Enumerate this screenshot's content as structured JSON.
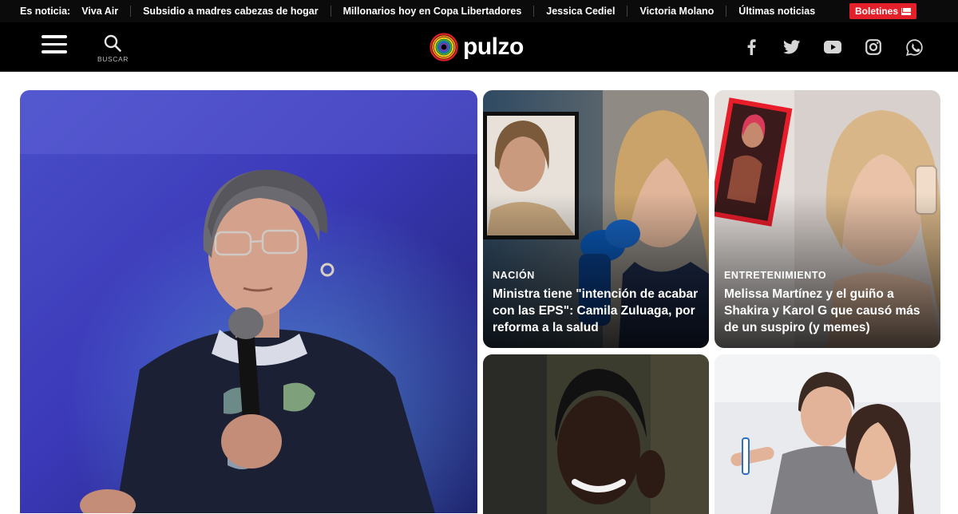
{
  "topbar": {
    "label": "Es noticia:",
    "links": [
      "Viva Air",
      "Subsidio a madres cabezas de hogar",
      "Millonarios hoy en Copa Libertadores",
      "Jessica Cediel",
      "Victoria Molano",
      "Últimas noticias"
    ],
    "newsletter_label": "Boletines"
  },
  "header": {
    "search_label": "BUSCAR",
    "logo_text": "pulzo",
    "social_icons": [
      "facebook-icon",
      "twitter-icon",
      "youtube-icon",
      "instagram-icon",
      "whatsapp-icon"
    ]
  },
  "cards": [
    {
      "category": "",
      "title": ""
    },
    {
      "category": "NACIÓN",
      "title": "Ministra tiene \"intención de acabar con las EPS\": Camila Zuluaga, por reforma a la salud"
    },
    {
      "category": "ENTRETENIMIENTO",
      "title": "Melissa Martínez y el guiño a Shakira y Karol G que causó más de un suspiro (y memes)"
    },
    {
      "category": "",
      "title": ""
    },
    {
      "category": "",
      "title": ""
    }
  ],
  "colors": {
    "header_bg": "#000000",
    "accent_red": "#e4202a",
    "text_light": "#ffffff"
  }
}
